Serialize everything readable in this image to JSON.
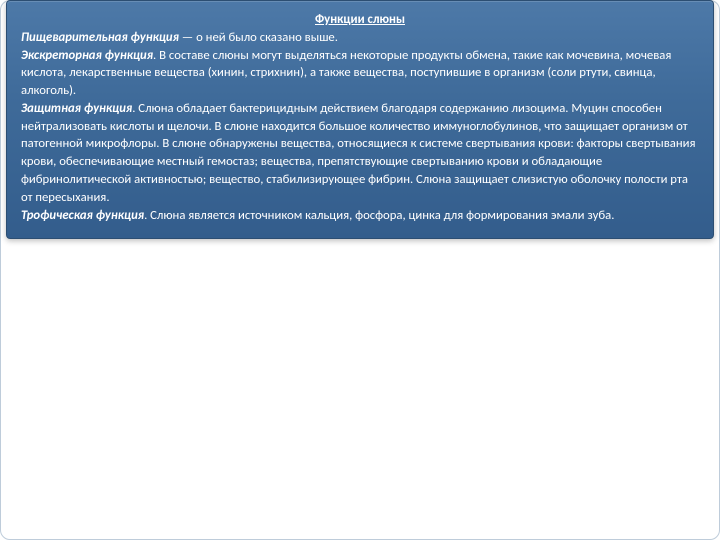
{
  "slide": {
    "title": "Функции слюны",
    "p1_label": "Пищеварительная функция",
    "p1_text": " — о ней было сказано выше.",
    "p2_label": "Экскреторная функция",
    "p2_text": ". В составе слюны могут выделяться некоторые продукты обмена, такие как мочевина, мочевая кислота, лекарственные вещества (хинин, стрихнин), а также вещества, поступившие в организм (соли ртути, свинца, алкоголь).",
    "p3_label": "Защитная функция",
    "p3_text": ". Слюна обладает бактерицидным действием благодаря содержанию лизоцима. Муцин способен нейтрализовать кислоты и щелочи. В слюне находится большое количество иммуноглобулинов, что защищает организм от патогенной микрофлоры. В слюне обнаружены вещества, относящиеся к системе свертывания крови: факторы свертывания крови, обеспечивающие местный гемостаз; вещества, препятствующие свертыванию крови и обладающие фибринолитической активностью; вещество, стабилизирующее фибрин. Слюна защищает слизистую оболочку полости рта от пересыхания.",
    "p4_label": "Трофическая функция",
    "p4_text": ". Слюна является источником кальция, фосфора, цинка для формирования эмали зуба."
  }
}
